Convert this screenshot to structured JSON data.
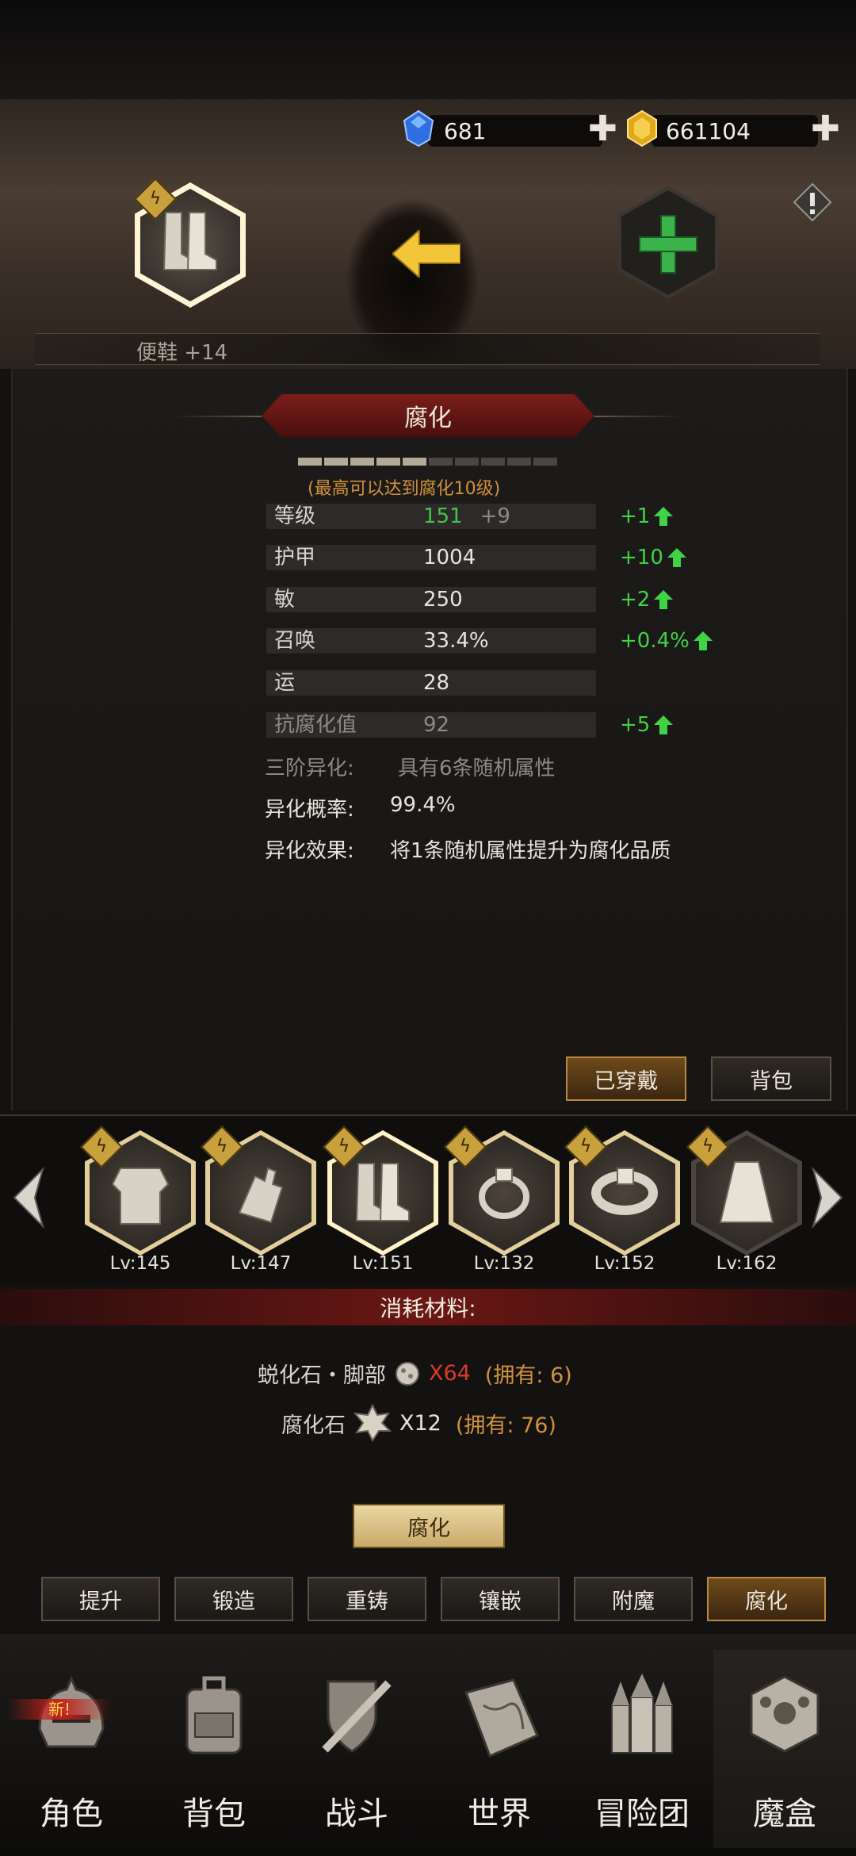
{
  "status_bar_text": "",
  "resources": {
    "gems": "681",
    "gold": "661104"
  },
  "header": {
    "item_name": "便鞋 +14",
    "equipped_icon": "boots-icon",
    "arrow_icon": "yellow-left-arrow-icon",
    "add_slot_icon": "green-plus-icon",
    "info_icon": "exclamation-diamond-icon"
  },
  "panel": {
    "title": "腐化",
    "progress": {
      "total": 10,
      "filled": 5
    },
    "max_note": "(最高可以达到腐化10级)",
    "stats": [
      {
        "label": "等级",
        "value": "151",
        "bonus": "+9",
        "increase": "+1"
      },
      {
        "label": "护甲",
        "value": "1004",
        "bonus": "",
        "increase": "+10"
      },
      {
        "label": "敏",
        "value": "250",
        "bonus": "",
        "increase": "+2"
      },
      {
        "label": "召唤",
        "value": "33.4%",
        "bonus": "",
        "increase": "+0.4%"
      },
      {
        "label": "运",
        "value": "28",
        "bonus": "",
        "increase": ""
      },
      {
        "label": "抗腐化值",
        "value": "92",
        "bonus": "",
        "increase": "+5"
      }
    ],
    "mutation_tier": "三阶异化:",
    "mutation_tier_desc": "具有6条随机属性",
    "mutation_chance_label": "异化概率:",
    "mutation_chance": "99.4%",
    "mutation_effect_label": "异化效果:",
    "mutation_effect": "将1条随机属性提升为腐化品质",
    "btn_equipped": "已穿戴",
    "btn_bag": "背包"
  },
  "equipment": [
    {
      "icon": "armor-icon",
      "level": "Lv:145"
    },
    {
      "icon": "gauntlet-icon",
      "level": "Lv:147"
    },
    {
      "icon": "boots-icon",
      "level": "Lv:151"
    },
    {
      "icon": "ring-icon",
      "level": "Lv:132"
    },
    {
      "icon": "belt-icon",
      "level": "Lv:152"
    },
    {
      "icon": "cape-icon",
      "level": "Lv:162"
    }
  ],
  "materials": {
    "title": "消耗材料:",
    "items": [
      {
        "name": "蜕化石・脚部",
        "qty": "X64",
        "owned": "(拥有: 6)"
      },
      {
        "name": "腐化石",
        "qty": "X12",
        "owned": "(拥有: 76)"
      }
    ],
    "action_button": "腐化"
  },
  "tabs": [
    "提升",
    "锻造",
    "重铸",
    "镶嵌",
    "附魔",
    "腐化"
  ],
  "active_tab": 5,
  "nav": [
    {
      "label": "角色",
      "icon": "helmet-icon",
      "badge": "新!"
    },
    {
      "label": "背包",
      "icon": "backpack-icon",
      "badge": ""
    },
    {
      "label": "战斗",
      "icon": "shield-sword-icon",
      "badge": ""
    },
    {
      "label": "世界",
      "icon": "map-scroll-icon",
      "badge": ""
    },
    {
      "label": "冒险团",
      "icon": "castle-icon",
      "badge": ""
    },
    {
      "label": "魔盒",
      "icon": "magic-cube-icon",
      "badge": ""
    }
  ],
  "colors": {
    "increase_green": "#3fd345",
    "level_green": "#44c44a",
    "red_qty": "#d93a2e",
    "owned_orange": "#d2923a",
    "banner_red": "#6a1714"
  }
}
